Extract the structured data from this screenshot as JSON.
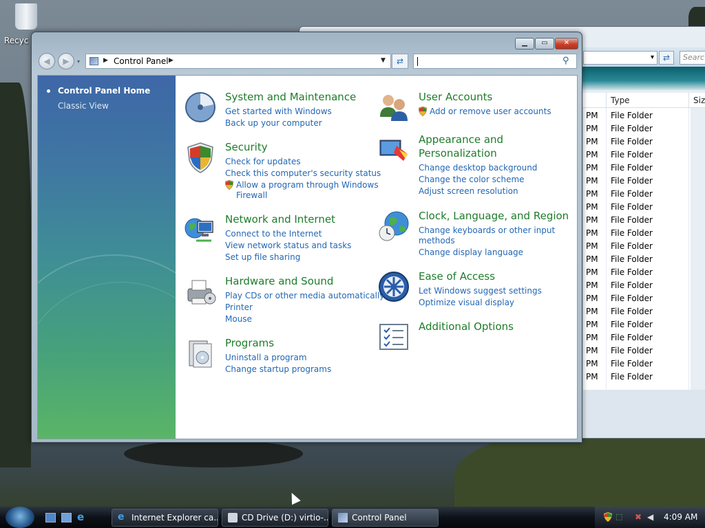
{
  "desktop": {
    "recycle_bin_label": "Recyc"
  },
  "background_window": {
    "search_placeholder": "Searc",
    "headers": {
      "type": "Type",
      "size": "Size"
    },
    "rows": [
      {
        "time": "PM",
        "type": "File Folder"
      },
      {
        "time": "PM",
        "type": "File Folder"
      },
      {
        "time": "PM",
        "type": "File Folder"
      },
      {
        "time": "PM",
        "type": "File Folder"
      },
      {
        "time": "PM",
        "type": "File Folder"
      },
      {
        "time": "PM",
        "type": "File Folder"
      },
      {
        "time": "PM",
        "type": "File Folder"
      },
      {
        "time": "PM",
        "type": "File Folder"
      },
      {
        "time": "PM",
        "type": "File Folder"
      },
      {
        "time": "PM",
        "type": "File Folder"
      },
      {
        "time": "PM",
        "type": "File Folder"
      },
      {
        "time": "PM",
        "type": "File Folder"
      },
      {
        "time": "PM",
        "type": "File Folder"
      },
      {
        "time": "PM",
        "type": "File Folder"
      },
      {
        "time": "PM",
        "type": "File Folder"
      },
      {
        "time": "PM",
        "type": "File Folder"
      },
      {
        "time": "PM",
        "type": "File Folder"
      },
      {
        "time": "PM",
        "type": "File Folder"
      },
      {
        "time": "PM",
        "type": "File Folder"
      },
      {
        "time": "PM",
        "type": "File Folder"
      },
      {
        "time": "PM",
        "type": "File Folder"
      }
    ]
  },
  "window": {
    "address": "Control Panel",
    "search_value": "",
    "sidebar": {
      "home": "Control Panel Home",
      "classic": "Classic View"
    },
    "categories": {
      "system": {
        "title": "System and Maintenance",
        "links": [
          "Get started with Windows",
          "Back up your computer"
        ]
      },
      "security": {
        "title": "Security",
        "links": [
          "Check for updates",
          "Check this computer's security status",
          "Allow a program through Windows",
          "Firewall"
        ]
      },
      "network": {
        "title": "Network and Internet",
        "links": [
          "Connect to the Internet",
          "View network status and tasks",
          "Set up file sharing"
        ]
      },
      "hardware": {
        "title": "Hardware and Sound",
        "links": [
          "Play CDs or other media automatically",
          "Printer",
          "Mouse"
        ]
      },
      "programs": {
        "title": "Programs",
        "links": [
          "Uninstall a program",
          "Change startup programs"
        ]
      },
      "users": {
        "title": "User Accounts",
        "links": [
          "Add or remove user accounts"
        ]
      },
      "appearance": {
        "title_line1": "Appearance and",
        "title_line2": "Personalization",
        "links": [
          "Change desktop background",
          "Change the color scheme",
          "Adjust screen resolution"
        ]
      },
      "clock": {
        "title": "Clock, Language, and Region",
        "links": [
          "Change keyboards or other input",
          "methods",
          "Change display language"
        ]
      },
      "ease": {
        "title": "Ease of Access",
        "links": [
          "Let Windows suggest settings",
          "Optimize visual display"
        ]
      },
      "additional": {
        "title": "Additional Options"
      }
    }
  },
  "taskbar": {
    "buttons": [
      "Internet Explorer ca...",
      "CD Drive (D:) virtio-...",
      "Control Panel"
    ],
    "clock": "4:09 AM"
  },
  "colors": {
    "category_title": "#1e7c2a",
    "link": "#2367b4",
    "sidebar_top": "#3e67a7",
    "sidebar_bottom": "#5ab567"
  }
}
